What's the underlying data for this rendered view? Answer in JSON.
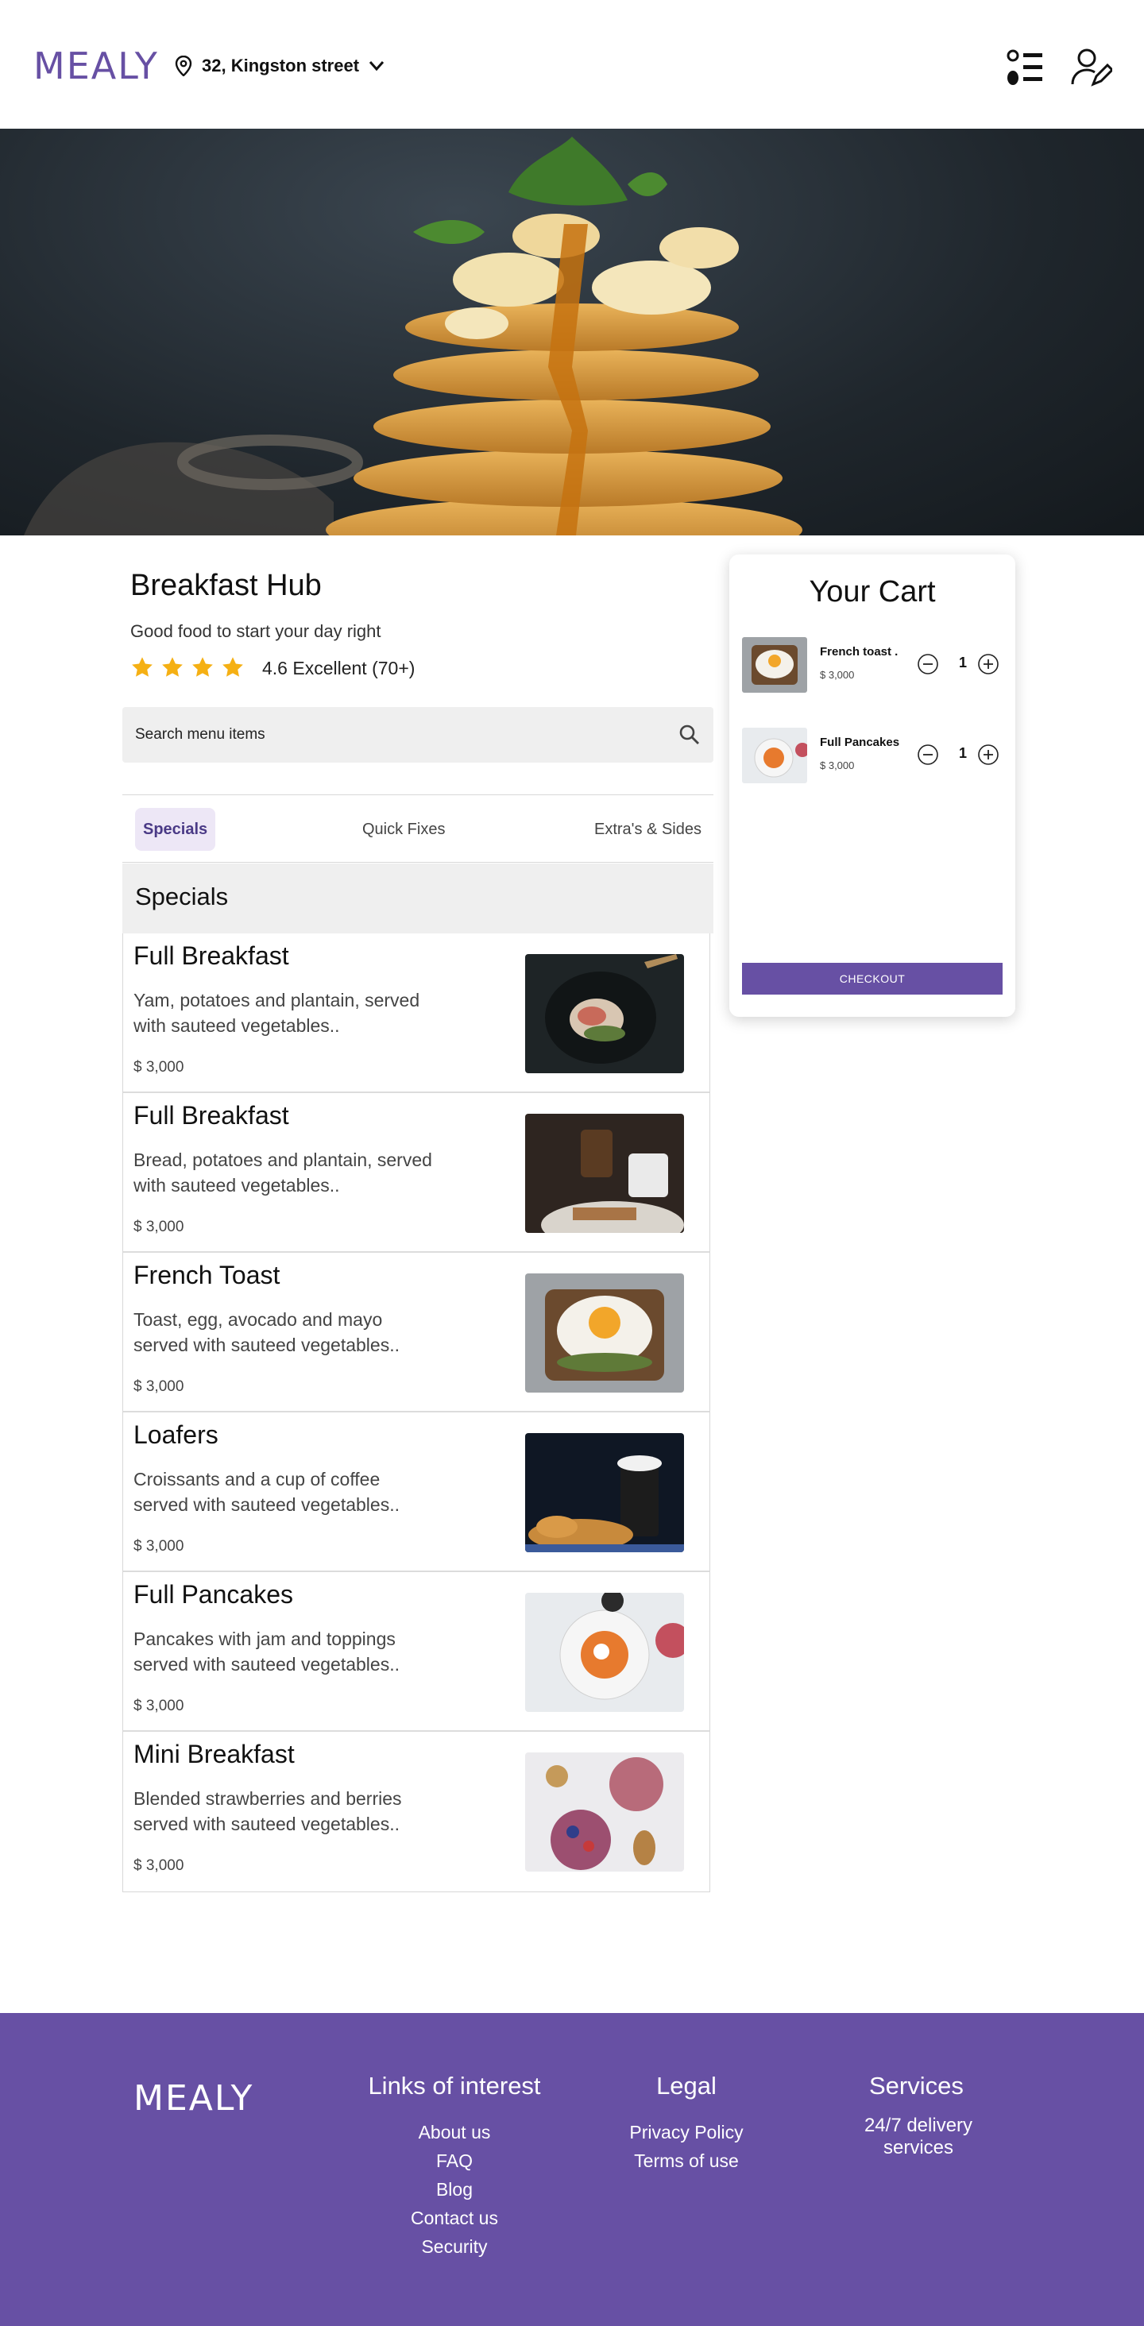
{
  "header": {
    "logo": "MEALY",
    "location": "32, Kingston street"
  },
  "restaurant": {
    "name": "Breakfast Hub",
    "tagline": "Good food to start your day right",
    "rating_text": "4.6 Excellent (70+)",
    "stars": 4
  },
  "search": {
    "placeholder": "Search menu items"
  },
  "tabs": [
    {
      "label": "Specials",
      "active": true
    },
    {
      "label": "Quick Fixes",
      "active": false
    },
    {
      "label": "Extra's & Sides",
      "active": false
    }
  ],
  "section_title": "Specials",
  "menu_items": [
    {
      "name": "Full Breakfast",
      "desc": "Yam, potatoes and plantain, served with sauteed vegetables..",
      "price": "$ 3,000"
    },
    {
      "name": "Full Breakfast",
      "desc": "Bread, potatoes and plantain, served with sauteed vegetables..",
      "price": "$ 3,000"
    },
    {
      "name": "French Toast",
      "desc": "Toast, egg, avocado and mayo served with sauteed vegetables..",
      "price": "$ 3,000"
    },
    {
      "name": "Loafers",
      "desc": "Croissants and a cup of coffee served with sauteed vegetables..",
      "price": "$ 3,000"
    },
    {
      "name": "Full Pancakes",
      "desc": "Pancakes with jam and toppings served with sauteed vegetables..",
      "price": "$ 3,000"
    },
    {
      "name": "Mini Breakfast",
      "desc": "Blended strawberries and berries served with sauteed vegetables..",
      "price": "$ 3,000"
    }
  ],
  "cart": {
    "title": "Your Cart",
    "items": [
      {
        "name": "French toast  .",
        "price": "$ 3,000",
        "qty": "1"
      },
      {
        "name": "Full Pancakes",
        "price": "$ 3,000",
        "qty": "1"
      }
    ],
    "checkout_label": "CHECKOUT"
  },
  "footer": {
    "logo": "MEALY",
    "links_title": "Links of interest",
    "links": [
      "About us",
      "FAQ",
      "Blog",
      "Contact us",
      "Security"
    ],
    "legal_title": "Legal",
    "legal": [
      "Privacy Policy",
      "Terms of use"
    ],
    "services_title": "Services",
    "services_line1": "24/7 delivery",
    "services_line2": "services"
  },
  "colors": {
    "brand": "#6750A4",
    "star": "#F5B014",
    "tab_active_bg": "#EDE7F6"
  }
}
